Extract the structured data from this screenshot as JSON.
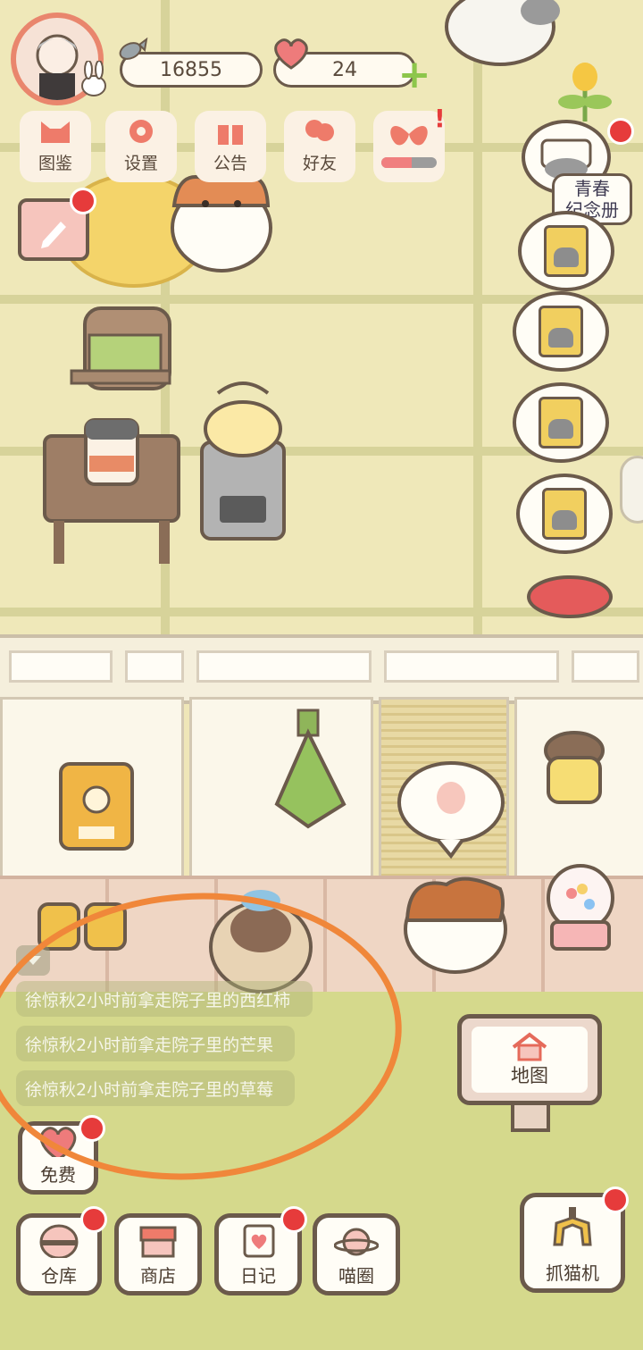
{
  "hud": {
    "fish_currency": "16855",
    "heart_currency": "24",
    "add_label": "+"
  },
  "menu": [
    {
      "name": "图鉴",
      "icon": "cat-head-icon"
    },
    {
      "name": "设置",
      "icon": "gear-icon"
    },
    {
      "name": "公告",
      "icon": "gift-icon"
    },
    {
      "name": "好友",
      "icon": "friends-icon"
    },
    {
      "name": "",
      "icon": "butterfly-event-icon"
    }
  ],
  "album": {
    "line1": "青春",
    "line2": "纪念册"
  },
  "feed": [
    "徐惊秋2小时前拿走院子里的西红柿",
    "徐惊秋2小时前拿走院子里的芒果",
    "徐惊秋2小时前拿走院子里的草莓"
  ],
  "free": {
    "label": "免费"
  },
  "map": {
    "label": "地图"
  },
  "bottom_nav": [
    {
      "label": "仓库",
      "icon": "storage-icon"
    },
    {
      "label": "商店",
      "icon": "shop-icon"
    },
    {
      "label": "日记",
      "icon": "diary-icon"
    },
    {
      "label": "喵圈",
      "icon": "cat-planet-icon"
    }
  ],
  "claw": {
    "label": "抓猫机",
    "icon": "claw-machine-icon"
  },
  "colors": {
    "accent_red": "#e63b3b",
    "outline": "#6b5a4b",
    "annotation": "#f0873a"
  }
}
